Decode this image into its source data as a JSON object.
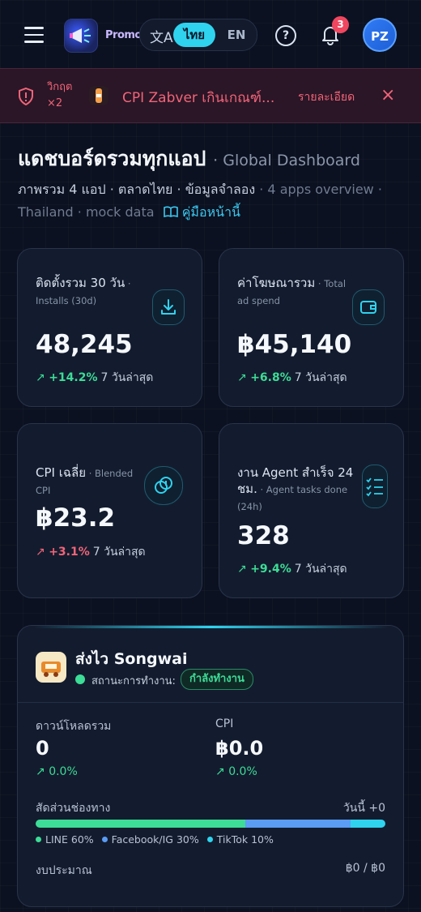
{
  "topbar": {
    "brand": "PromoteAPP",
    "lang_icon": "文A",
    "lang_th": "ไทย",
    "lang_en": "EN",
    "help": "?",
    "notifications": "3",
    "avatar": "PZ"
  },
  "alert": {
    "count_line1": "วิกฤต",
    "count_line2": "×2",
    "message": "CPI Zabver เกินเกณฑ์...",
    "detail": "รายละเอียด",
    "close": "×"
  },
  "header": {
    "title_th": "แดชบอร์ดรวมทุกแอป",
    "title_en": "· Global Dashboard",
    "subtitle_th": "ภาพรวม 4 แอป · ตลาดไทย · ข้อมูลจำลอง",
    "subtitle_en": " · 4 apps overview · Thailand · mock data",
    "guide": "คู่มือหน้านี้"
  },
  "kpis": [
    {
      "label": "ติดตั้งรวม 30 วัน",
      "label_en": " · Installs (30d)",
      "value": "48,245",
      "delta": "+14.2%",
      "period": "7 วันล่าสุด",
      "trend": "up",
      "icon": "download-icon"
    },
    {
      "label": "ค่าโฆษณารวม",
      "label_en": " · Total ad spend",
      "value": "฿45,140",
      "delta": "+6.8%",
      "period": "7 วันล่าสุด",
      "trend": "up",
      "icon": "wallet-icon"
    },
    {
      "label": "CPI เฉลี่ย",
      "label_en": " · Blended CPI",
      "value": "฿23.2",
      "delta": "+3.1%",
      "period": "7 วันล่าสุด",
      "trend": "down",
      "icon": "coins-icon"
    },
    {
      "label": "งาน Agent สำเร็จ 24 ชม.",
      "label_en": " · Agent tasks done (24h)",
      "value": "328",
      "delta": "+9.4%",
      "period": "7 วันล่าสุด",
      "trend": "up",
      "icon": "checklist-icon"
    }
  ],
  "app": {
    "name": "ส่งไว Songwai",
    "status_label": "สถานะการทำงาน:",
    "status": "กำลังทำงาน",
    "downloads_label": "ดาวน์โหลดรวม",
    "downloads_value": "0",
    "downloads_delta": "0.0%",
    "cpi_label": "CPI",
    "cpi_value": "฿0.0",
    "cpi_delta": "0.0%",
    "mix_label": "สัดส่วนช่องทาง",
    "mix_today": "วันนี้ +0",
    "channels": [
      {
        "name": "LINE 60%",
        "share": 60,
        "color": "#3ddc97"
      },
      {
        "name": "Facebook/IG 30%",
        "share": 30,
        "color": "#5b9cf5"
      },
      {
        "name": "TikTok 10%",
        "share": 10,
        "color": "#2fd3ee"
      }
    ],
    "budget_label": "งบประมาณ",
    "budget_value": "฿0 / ฿0"
  }
}
